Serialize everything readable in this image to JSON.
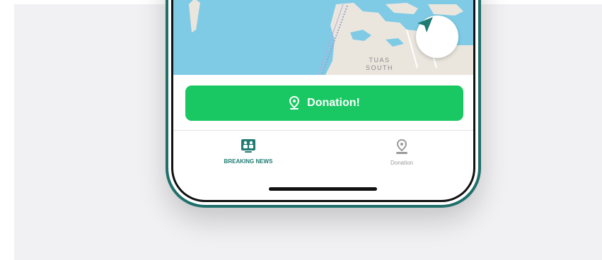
{
  "map": {
    "label_line1": "TUAS",
    "label_line2": "SOUTH",
    "locate_icon": "navigation-arrow-icon"
  },
  "donation_button": {
    "label": "Donation!",
    "icon": "map-pin-icon"
  },
  "tabs": [
    {
      "label": "BREAKING NEWS",
      "icon": "news-board-icon",
      "active": true
    },
    {
      "label": "Donation",
      "icon": "map-pin-icon",
      "active": false
    }
  ],
  "colors": {
    "accent_green": "#19c862",
    "teal": "#1f7b72",
    "water": "#7fcbe6",
    "land": "#eae6de"
  }
}
